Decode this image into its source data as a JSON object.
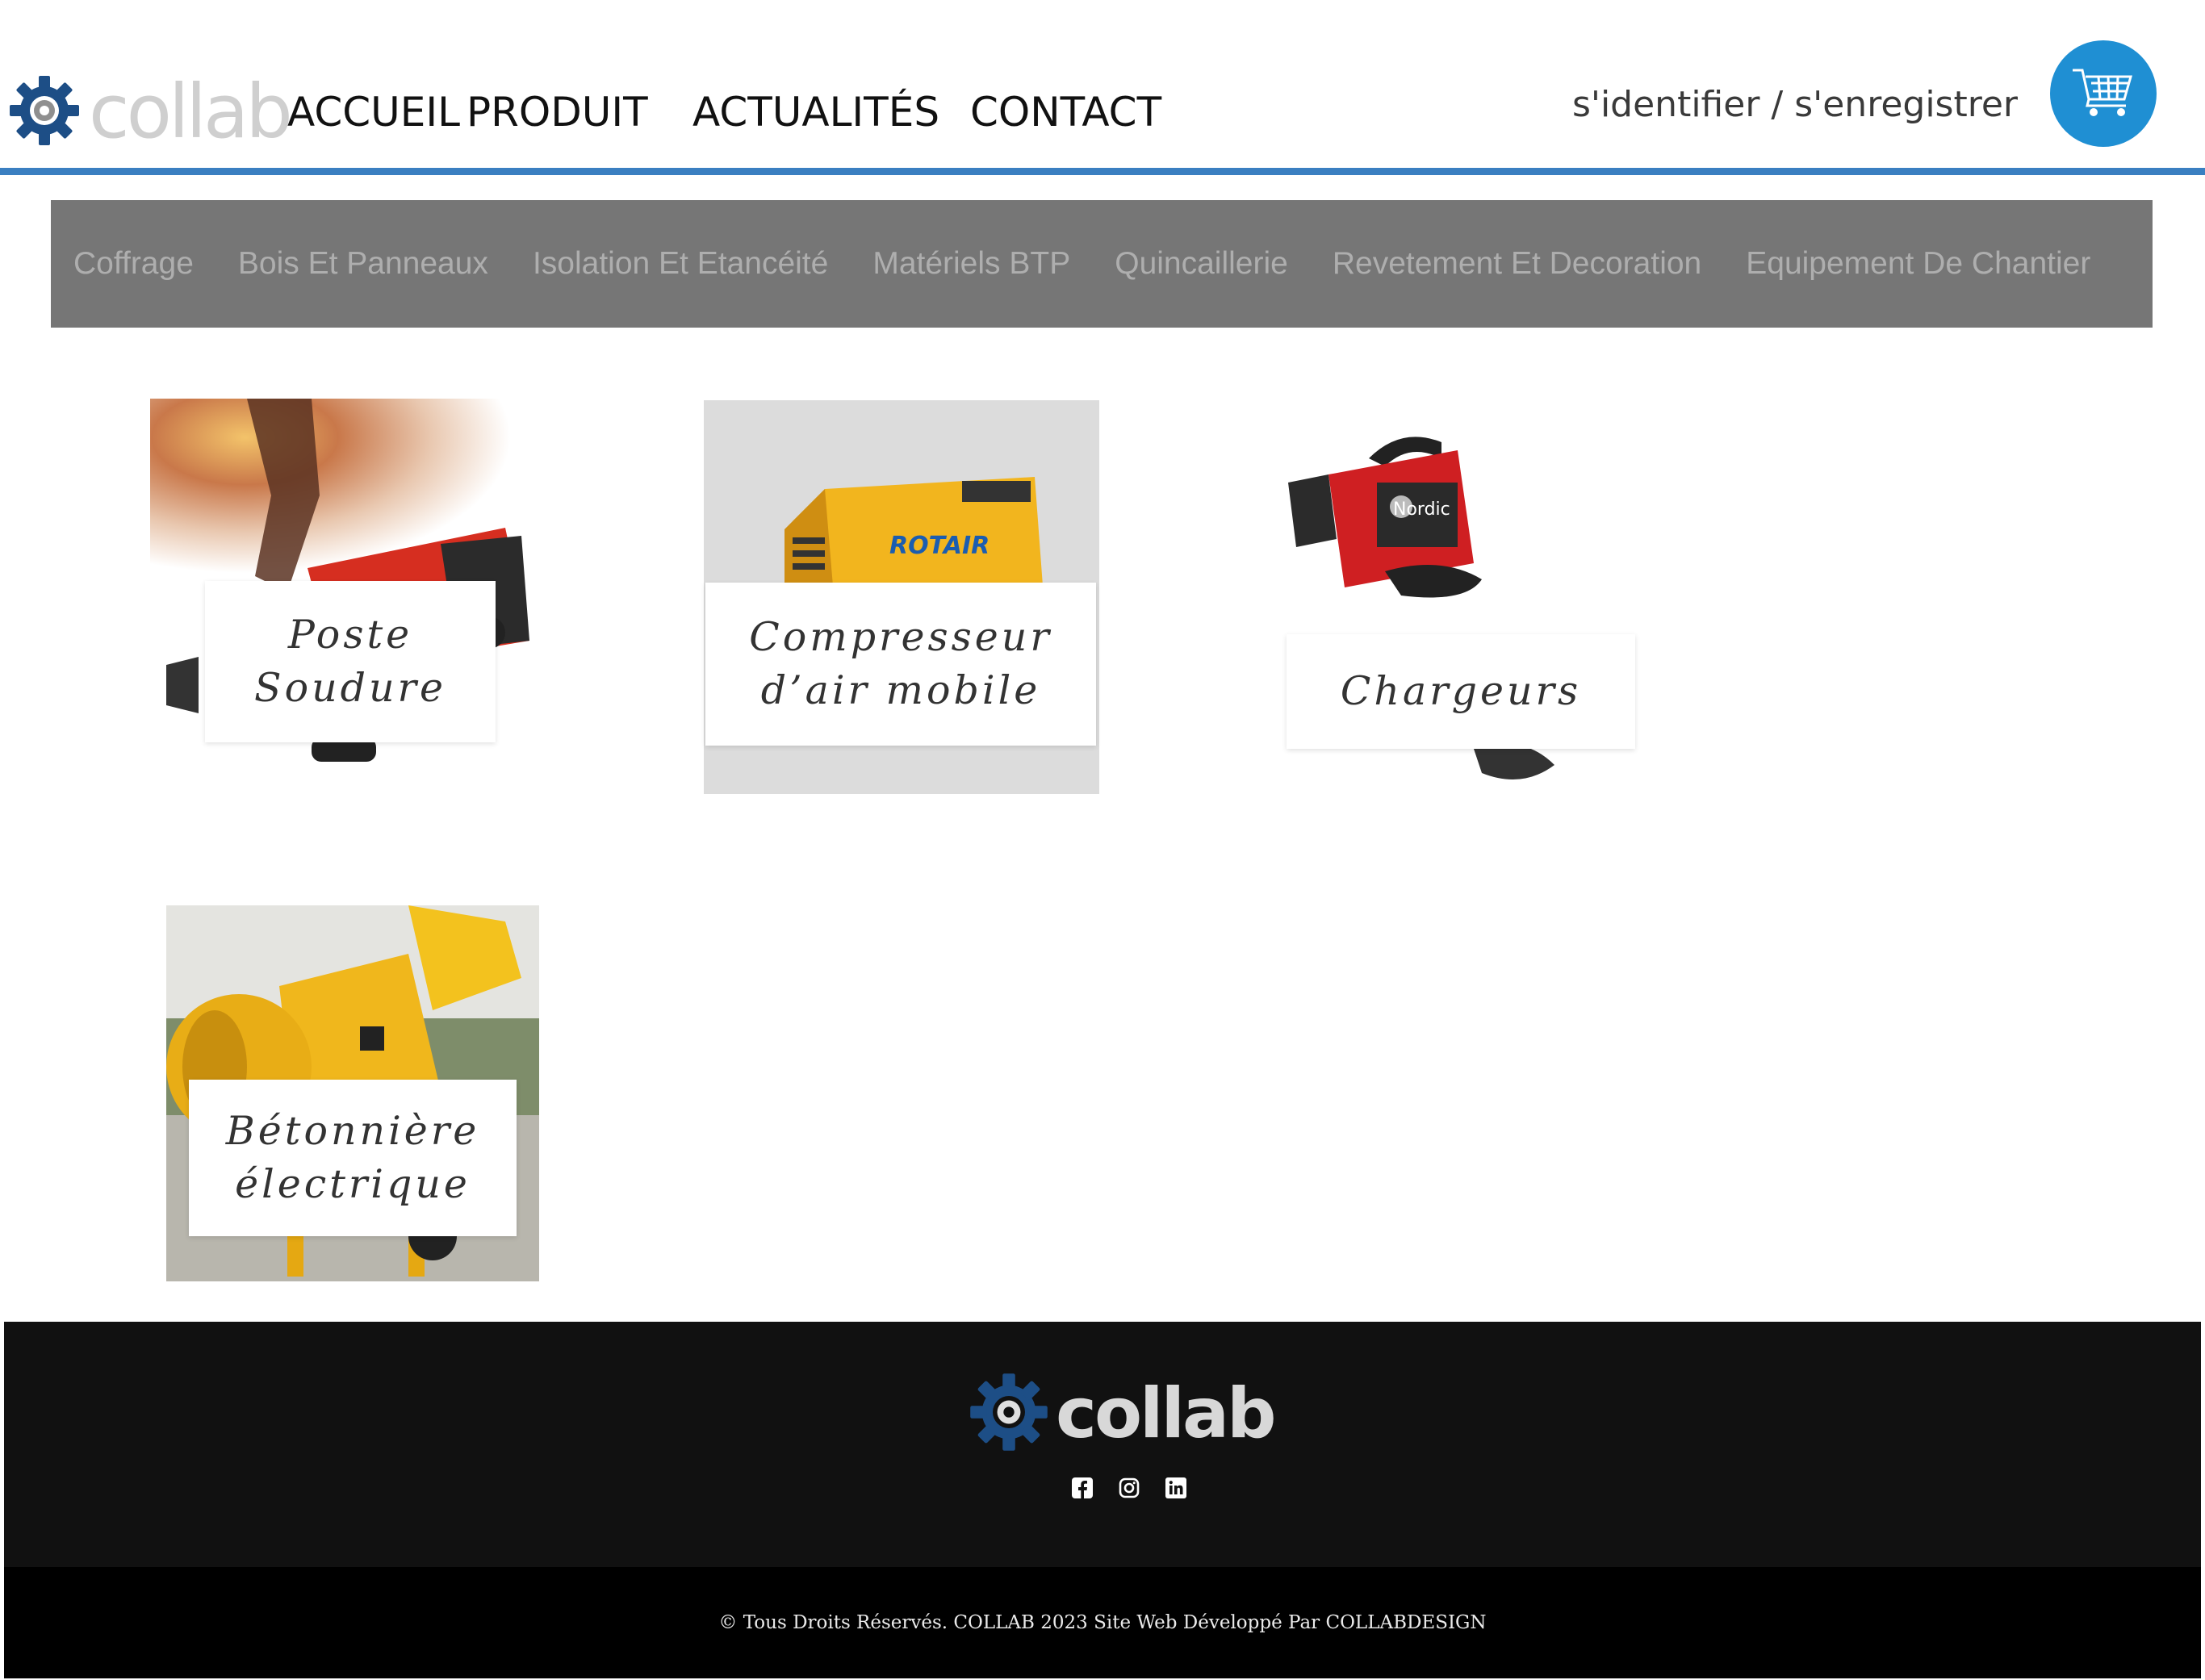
{
  "header": {
    "logo_text": "collab",
    "nav": [
      "ACCUEIL",
      "PRODUIT",
      "ACTUALITÉS",
      "CONTACT"
    ],
    "auth_link": "s'identifier / s'enregistrer",
    "accent_color": "#3a7fc1",
    "cart_color": "#1f8fd3"
  },
  "categories": [
    "Coffrage",
    "Bois Et Panneaux",
    "Isolation Et Etancéité",
    "Matériels BTP",
    "Quincaillerie",
    "Revetement Et Decoration",
    "Equipement De Chantier"
  ],
  "products": [
    {
      "label": "Poste\nSoudure"
    },
    {
      "label": "Compresseur\nd’air mobile"
    },
    {
      "label": "Chargeurs"
    },
    {
      "label": "Bétonnière\nélectrique"
    }
  ],
  "footer": {
    "logo_text": "collab",
    "social": [
      "facebook-icon",
      "instagram-icon",
      "linkedin-icon"
    ],
    "copyright": "© Tous Droits Réservés. COLLAB 2023 Site Web Développé Par COLLABDESIGN"
  }
}
